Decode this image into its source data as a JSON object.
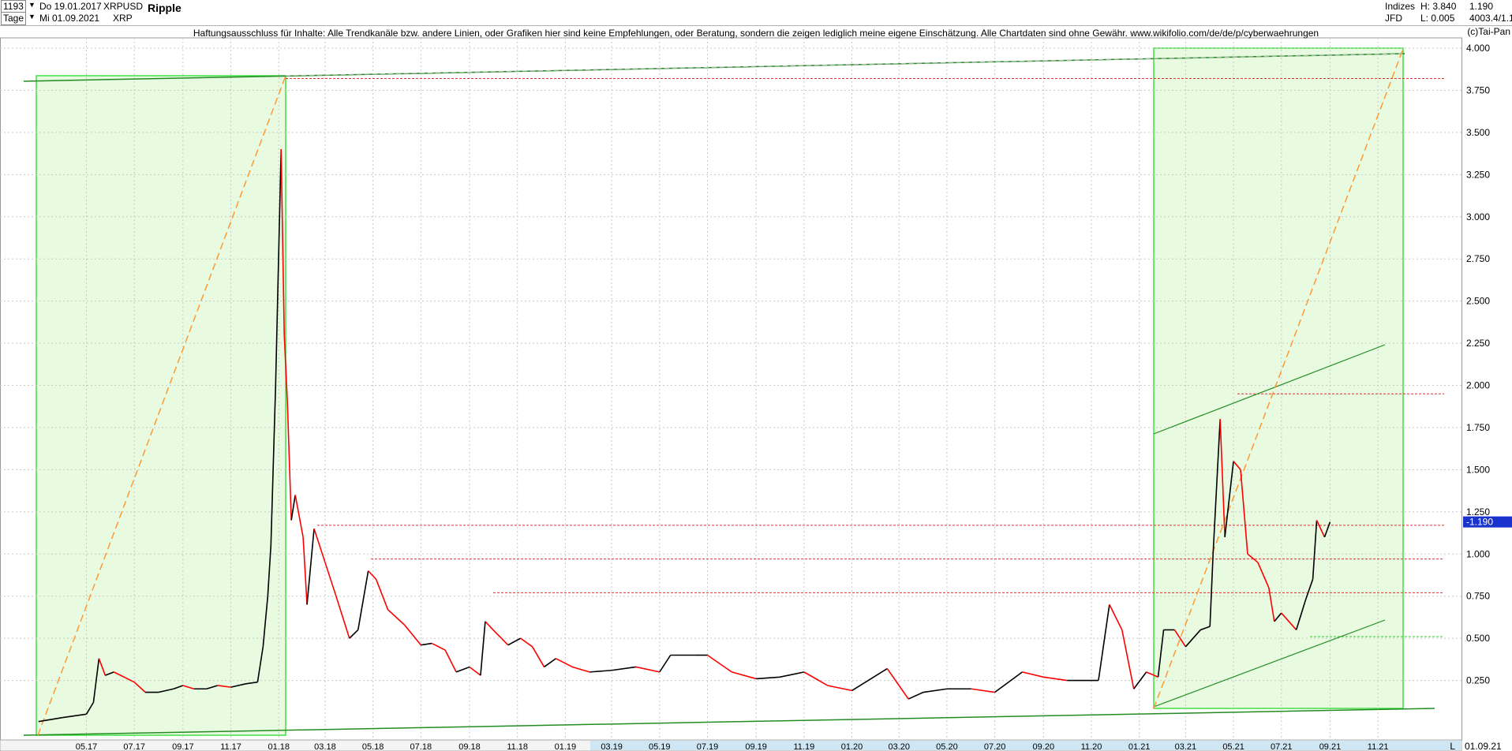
{
  "header": {
    "count": "1193",
    "start_date": "Do 19.01.2017",
    "period": "Tage",
    "end_date": "Mi 01.09.2021",
    "symbol": "XRPUSD",
    "symbol_sub": "XRP",
    "name": "Ripple",
    "group": "Indizes",
    "source": "JFD",
    "high": "H: 3.840",
    "low": "L: 0.005",
    "last": "1.190",
    "extra": "4003.4/1.1",
    "brand": "(c)Tai-Pan"
  },
  "notice": "Haftungsausschluss für Inhalte: Alle Trendkanäle bzw. andere Linien, oder Grafiken hier sind keine Empfehlungen, oder Beratung, sondern die zeigen lediglich meine eigene Einschätzung. Alle Chartdaten sind ohne Gewähr.  www.wikifolio.com/de/de/p/cyberwaehrungen",
  "footer": {
    "date": "01.09.21",
    "scale_mode": "L"
  },
  "colors": {
    "up": "#000000",
    "down": "#ff0000",
    "channel": "#228b22",
    "zone_fill": "#e8fbe0",
    "zone_border": "#44dd44",
    "dashed_orange": "#ff9933",
    "resistance": "#e03030",
    "last_badge": "#1a33cc"
  },
  "chart_data": {
    "type": "line",
    "title": "Ripple",
    "xlabel": "",
    "ylabel": "",
    "ylim": [
      0,
      4.0
    ],
    "yticks": [
      "0.250",
      "0.500",
      "0.750",
      "1.000",
      "1.250",
      "1.500",
      "1.750",
      "2.000",
      "2.250",
      "2.500",
      "2.750",
      "3.000",
      "3.250",
      "3.500",
      "3.750",
      "4.000"
    ],
    "xticks": [
      "05.17",
      "07.17",
      "09.17",
      "11.17",
      "01.18",
      "03.18",
      "05.18",
      "07.18",
      "09.18",
      "11.18",
      "01.19",
      "03.19",
      "05.19",
      "07.19",
      "09.19",
      "11.19",
      "01.20",
      "03.20",
      "05.20",
      "07.20",
      "09.20",
      "11.20",
      "01.21",
      "03.21",
      "05.21",
      "07.21",
      "09.21",
      "11.21"
    ],
    "grid": true,
    "last_value": 1.19,
    "series": [
      {
        "values": [
          {
            "x": "2017-03-01",
            "y": 0.006
          },
          {
            "x": "2017-04-01",
            "y": 0.03
          },
          {
            "x": "2017-05-01",
            "y": 0.05
          },
          {
            "x": "2017-05-10",
            "y": 0.12
          },
          {
            "x": "2017-05-17",
            "y": 0.38
          },
          {
            "x": "2017-05-25",
            "y": 0.28
          },
          {
            "x": "2017-06-05",
            "y": 0.3
          },
          {
            "x": "2017-07-01",
            "y": 0.24
          },
          {
            "x": "2017-07-15",
            "y": 0.18
          },
          {
            "x": "2017-08-01",
            "y": 0.18
          },
          {
            "x": "2017-08-20",
            "y": 0.2
          },
          {
            "x": "2017-09-01",
            "y": 0.22
          },
          {
            "x": "2017-09-15",
            "y": 0.2
          },
          {
            "x": "2017-10-01",
            "y": 0.2
          },
          {
            "x": "2017-10-15",
            "y": 0.22
          },
          {
            "x": "2017-11-01",
            "y": 0.21
          },
          {
            "x": "2017-11-20",
            "y": 0.23
          },
          {
            "x": "2017-12-05",
            "y": 0.24
          },
          {
            "x": "2017-12-12",
            "y": 0.45
          },
          {
            "x": "2017-12-18",
            "y": 0.75
          },
          {
            "x": "2017-12-22",
            "y": 1.05
          },
          {
            "x": "2017-12-28",
            "y": 2.0
          },
          {
            "x": "2018-01-04",
            "y": 3.4
          },
          {
            "x": "2018-01-08",
            "y": 2.3
          },
          {
            "x": "2018-01-12",
            "y": 1.9
          },
          {
            "x": "2018-01-17",
            "y": 1.2
          },
          {
            "x": "2018-01-22",
            "y": 1.35
          },
          {
            "x": "2018-02-01",
            "y": 1.1
          },
          {
            "x": "2018-02-06",
            "y": 0.7
          },
          {
            "x": "2018-02-15",
            "y": 1.15
          },
          {
            "x": "2018-03-01",
            "y": 0.95
          },
          {
            "x": "2018-03-15",
            "y": 0.75
          },
          {
            "x": "2018-04-01",
            "y": 0.5
          },
          {
            "x": "2018-04-12",
            "y": 0.55
          },
          {
            "x": "2018-04-25",
            "y": 0.9
          },
          {
            "x": "2018-05-05",
            "y": 0.85
          },
          {
            "x": "2018-05-20",
            "y": 0.67
          },
          {
            "x": "2018-06-10",
            "y": 0.58
          },
          {
            "x": "2018-07-01",
            "y": 0.46
          },
          {
            "x": "2018-07-15",
            "y": 0.47
          },
          {
            "x": "2018-08-01",
            "y": 0.43
          },
          {
            "x": "2018-08-15",
            "y": 0.3
          },
          {
            "x": "2018-09-01",
            "y": 0.33
          },
          {
            "x": "2018-09-15",
            "y": 0.28
          },
          {
            "x": "2018-09-21",
            "y": 0.6
          },
          {
            "x": "2018-10-01",
            "y": 0.55
          },
          {
            "x": "2018-10-20",
            "y": 0.46
          },
          {
            "x": "2018-11-05",
            "y": 0.5
          },
          {
            "x": "2018-11-20",
            "y": 0.45
          },
          {
            "x": "2018-12-05",
            "y": 0.33
          },
          {
            "x": "2018-12-20",
            "y": 0.38
          },
          {
            "x": "2019-01-10",
            "y": 0.33
          },
          {
            "x": "2019-02-01",
            "y": 0.3
          },
          {
            "x": "2019-03-01",
            "y": 0.31
          },
          {
            "x": "2019-04-01",
            "y": 0.33
          },
          {
            "x": "2019-05-01",
            "y": 0.3
          },
          {
            "x": "2019-05-15",
            "y": 0.4
          },
          {
            "x": "2019-06-15",
            "y": 0.4
          },
          {
            "x": "2019-07-01",
            "y": 0.4
          },
          {
            "x": "2019-08-01",
            "y": 0.3
          },
          {
            "x": "2019-09-01",
            "y": 0.26
          },
          {
            "x": "2019-10-01",
            "y": 0.27
          },
          {
            "x": "2019-11-01",
            "y": 0.3
          },
          {
            "x": "2019-12-01",
            "y": 0.22
          },
          {
            "x": "2020-01-01",
            "y": 0.19
          },
          {
            "x": "2020-02-15",
            "y": 0.32
          },
          {
            "x": "2020-03-13",
            "y": 0.14
          },
          {
            "x": "2020-04-01",
            "y": 0.18
          },
          {
            "x": "2020-05-01",
            "y": 0.2
          },
          {
            "x": "2020-06-01",
            "y": 0.2
          },
          {
            "x": "2020-07-01",
            "y": 0.18
          },
          {
            "x": "2020-08-05",
            "y": 0.3
          },
          {
            "x": "2020-09-01",
            "y": 0.27
          },
          {
            "x": "2020-10-01",
            "y": 0.25
          },
          {
            "x": "2020-11-10",
            "y": 0.25
          },
          {
            "x": "2020-11-24",
            "y": 0.7
          },
          {
            "x": "2020-12-10",
            "y": 0.55
          },
          {
            "x": "2020-12-25",
            "y": 0.2
          },
          {
            "x": "2021-01-10",
            "y": 0.3
          },
          {
            "x": "2021-01-25",
            "y": 0.27
          },
          {
            "x": "2021-02-01",
            "y": 0.55
          },
          {
            "x": "2021-02-15",
            "y": 0.55
          },
          {
            "x": "2021-03-01",
            "y": 0.45
          },
          {
            "x": "2021-03-20",
            "y": 0.55
          },
          {
            "x": "2021-04-01",
            "y": 0.57
          },
          {
            "x": "2021-04-05",
            "y": 1.0
          },
          {
            "x": "2021-04-14",
            "y": 1.8
          },
          {
            "x": "2021-04-20",
            "y": 1.1
          },
          {
            "x": "2021-05-01",
            "y": 1.55
          },
          {
            "x": "2021-05-10",
            "y": 1.5
          },
          {
            "x": "2021-05-19",
            "y": 1.0
          },
          {
            "x": "2021-06-01",
            "y": 0.95
          },
          {
            "x": "2021-06-15",
            "y": 0.8
          },
          {
            "x": "2021-06-22",
            "y": 0.6
          },
          {
            "x": "2021-07-01",
            "y": 0.65
          },
          {
            "x": "2021-07-20",
            "y": 0.55
          },
          {
            "x": "2021-08-01",
            "y": 0.73
          },
          {
            "x": "2021-08-10",
            "y": 0.85
          },
          {
            "x": "2021-08-15",
            "y": 1.2
          },
          {
            "x": "2021-08-25",
            "y": 1.1
          },
          {
            "x": "2021-09-01",
            "y": 1.19
          }
        ]
      }
    ],
    "resistance_levels": [
      3.82,
      1.95,
      1.17,
      0.97,
      0.77,
      0.51
    ],
    "annotations": [
      "shaded zone 2017-03 to 2018-01",
      "shaded zone 2020-12 to 2021-11",
      "rising channel 2020-12 to 2021-09"
    ]
  }
}
